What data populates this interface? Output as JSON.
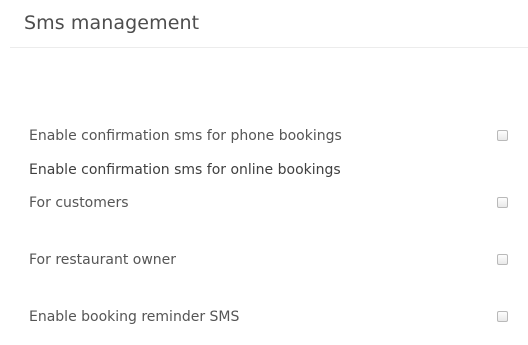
{
  "panel": {
    "title": "Sms management"
  },
  "settings": {
    "phone_bookings": {
      "label": "Enable confirmation sms for phone bookings",
      "checked": false
    },
    "online_heading": "Enable confirmation sms for online bookings",
    "online_customers": {
      "label": "For customers",
      "checked": false
    },
    "online_owner": {
      "label": "For restaurant owner",
      "checked": false
    },
    "reminder": {
      "label": "Enable booking reminder SMS",
      "checked": false
    }
  }
}
